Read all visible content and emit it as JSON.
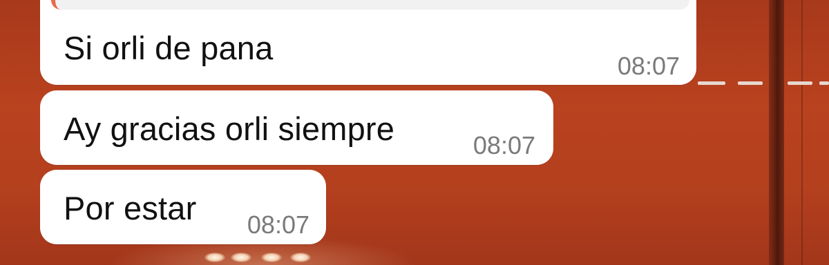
{
  "chat": {
    "background_color": "#b8401f",
    "bubble_color": "#ffffff",
    "quote_accent_color": "#e96a4c",
    "messages": [
      {
        "text": "Si orli de pana",
        "time": "08:07",
        "has_quoted_reply": true
      },
      {
        "text": "Ay gracias orli siempre",
        "time": "08:07"
      },
      {
        "text": "Por estar",
        "time": "08:07"
      }
    ]
  }
}
